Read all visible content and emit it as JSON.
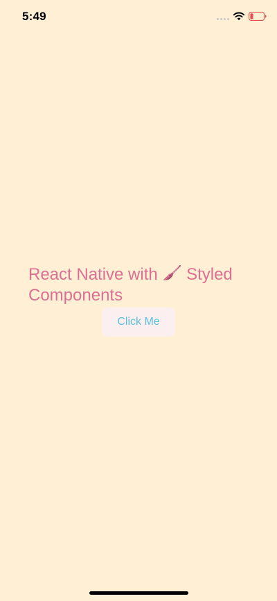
{
  "status_bar": {
    "time": "5:49"
  },
  "main": {
    "title_before": "React Native with ",
    "title_after": " Styled Components",
    "button_label": "Click Me"
  },
  "colors": {
    "background": "#FFEFD5",
    "title": "#DB7093",
    "button_text": "#5BC0DE",
    "button_background": "#FBEFEF",
    "battery_level": "#E05050"
  },
  "icons": {
    "title_emoji": "brush-icon",
    "wifi": "wifi-icon",
    "battery": "battery-icon"
  }
}
